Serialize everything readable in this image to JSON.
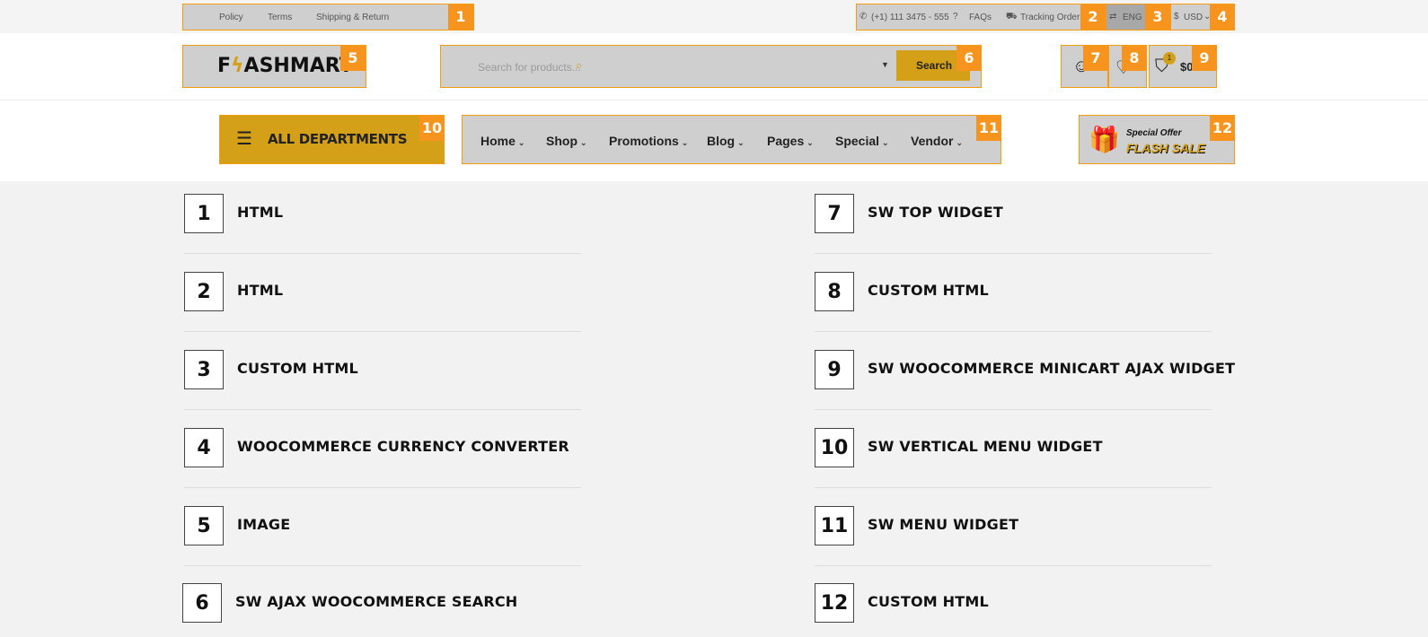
{
  "topbar": {
    "links": [
      "Policy",
      "Terms",
      "Shipping & Return"
    ],
    "phone": "(+1) 111 3475 - 555",
    "faqs": "FAQs",
    "tracking": "Tracking Orders",
    "language": "ENG",
    "currency": "USD"
  },
  "header": {
    "logo_text_a": "F",
    "logo_text_b": "ASHMART",
    "search_placeholder": "Search for products...",
    "search_button": "Search",
    "cart_count": "1",
    "cart_total": "$0"
  },
  "nav": {
    "departments": "ALL DEPARTMENTS",
    "menu": [
      "Home",
      "Shop",
      "Promotions",
      "Blog",
      "Pages",
      "Special",
      "Vendor"
    ],
    "promo_line1": "Special Offer",
    "promo_line2": "FLASH SALE"
  },
  "badges": [
    "1",
    "2",
    "3",
    "4",
    "5",
    "6",
    "7",
    "8",
    "9",
    "10",
    "11",
    "12"
  ],
  "legend_left": [
    {
      "num": "1",
      "label": "HTML"
    },
    {
      "num": "2",
      "label": "HTML"
    },
    {
      "num": "3",
      "label": "CUSTOM HTML"
    },
    {
      "num": "4",
      "label": "WOOCOMMERCE CURRENCY CONVERTER"
    },
    {
      "num": "5",
      "label": "IMAGE"
    },
    {
      "num": "6",
      "label": "SW AJAX WOOCOMMERCE SEARCH"
    }
  ],
  "legend_right": [
    {
      "num": "7",
      "label": "SW TOP WIDGET"
    },
    {
      "num": "8",
      "label": "CUSTOM HTML"
    },
    {
      "num": "9",
      "label": "SW WOOCOMMERCE MINICART AJAX WIDGET"
    },
    {
      "num": "10",
      "label": "SW VERTICAL MENU WIDGET"
    },
    {
      "num": "11",
      "label": "SW MENU WIDGET"
    },
    {
      "num": "12",
      "label": "CUSTOM HTML"
    }
  ],
  "colors": {
    "accent": "#f7941d",
    "gold": "#d4a017",
    "zone": "#cfcfcf"
  }
}
